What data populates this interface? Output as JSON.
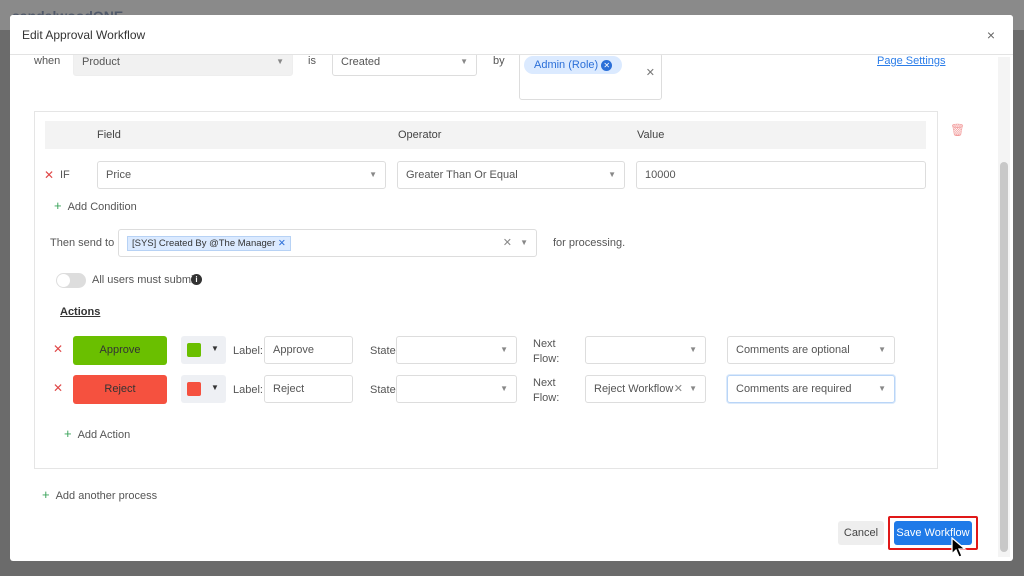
{
  "background": {
    "app_name": "sandalwoodONE"
  },
  "modal": {
    "title": "Edit Approval Workflow",
    "close": "×"
  },
  "trigger": {
    "when_label": "when",
    "entity": "Product",
    "is_label": "is",
    "event": "Created",
    "by_label": "by",
    "by_tag": "Admin (Role)",
    "page_settings": "Page Settings"
  },
  "conditions": {
    "headers": {
      "field": "Field",
      "operator": "Operator",
      "value": "Value"
    },
    "rows": [
      {
        "keyword": "IF",
        "field": "Price",
        "operator": "Greater Than Or Equal",
        "value": "10000"
      }
    ],
    "add_condition": "Add Condition"
  },
  "send": {
    "label": "Then send to",
    "tag": "[SYS] Created By @The Manager",
    "suffix": "for processing."
  },
  "all_users": {
    "label": "All users must submit",
    "on": false
  },
  "actions": {
    "title": "Actions",
    "label_label": "Label:",
    "state_label": "State:",
    "next_flow_label_1": "Next",
    "next_flow_label_2": "Flow:",
    "items": [
      {
        "button": "Approve",
        "color": "#6abf00",
        "label": "Approve",
        "state": "",
        "next_flow": "",
        "comments": "Comments are optional"
      },
      {
        "button": "Reject",
        "color": "#f5513f",
        "label": "Reject",
        "state": "",
        "next_flow": "Reject Workflow",
        "comments": "Comments are required"
      }
    ],
    "add_action": "Add Action"
  },
  "add_process": "Add another process",
  "footer": {
    "cancel": "Cancel",
    "save": "Save Workflow"
  }
}
